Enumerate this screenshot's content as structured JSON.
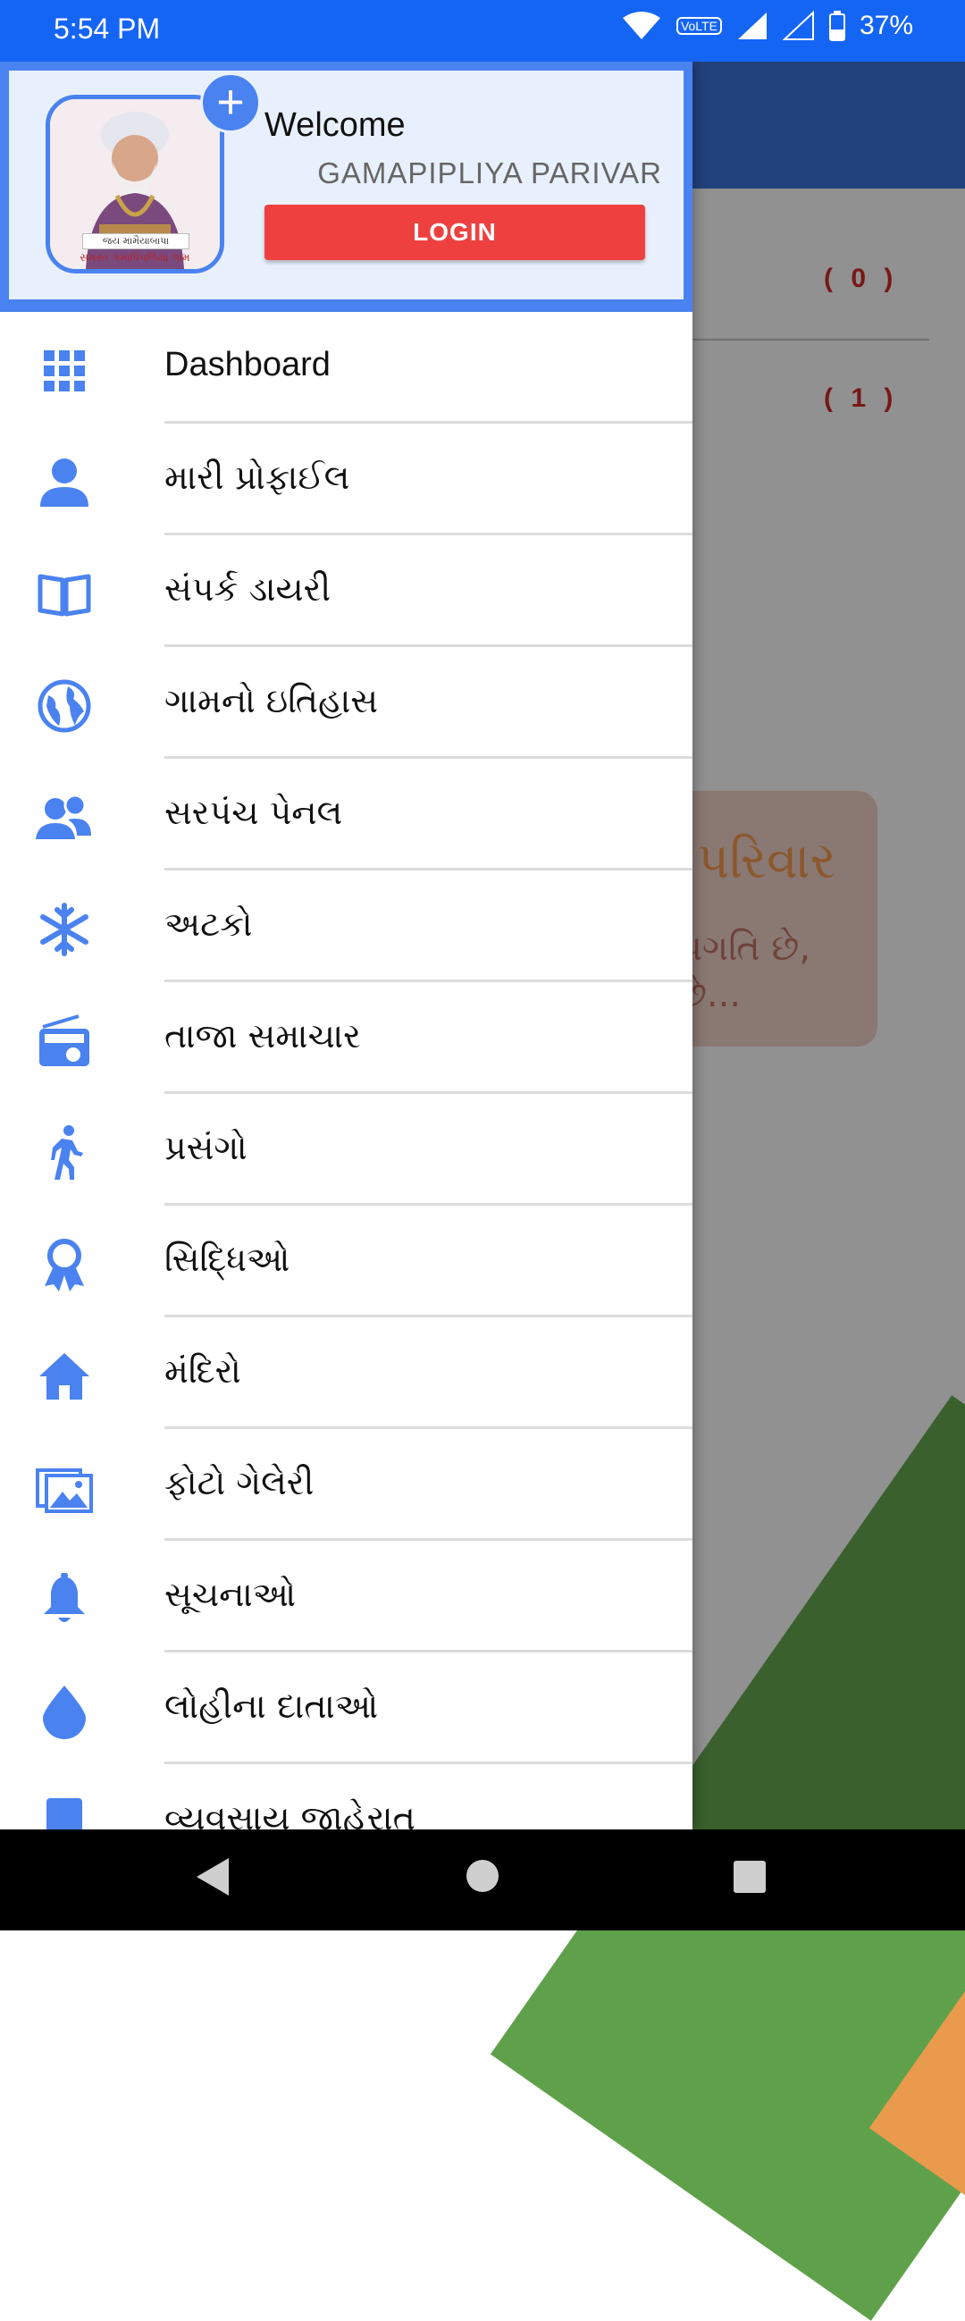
{
  "status_bar": {
    "time": "5:54 PM",
    "battery": "37%",
    "network_badge": "VoLTE"
  },
  "background": {
    "counts": [
      "( 0 )",
      "( 1 )"
    ],
    "card_title": "પરિવાર",
    "card_text_line1": "પ્રગતિ છે,",
    "card_text_line2": "છે..."
  },
  "drawer": {
    "welcome": "Welcome",
    "org_name": "GAMAPIPLIYA PARIVAR",
    "login_label": "LOGIN",
    "avatar_caption_top": "જય મામૈયાબાપા",
    "avatar_caption_bottom": "સમસ્ત ગમાપિપળિયા ગામ",
    "add_icon": "plus-icon",
    "items": [
      {
        "label": "Dashboard",
        "icon": "grid-icon"
      },
      {
        "label": "મારી પ્રોફાઈલ",
        "icon": "person-icon"
      },
      {
        "label": "સંપર્ક ડાયરી",
        "icon": "book-icon"
      },
      {
        "label": "ગામનો ઇતિહાસ",
        "icon": "globe-icon"
      },
      {
        "label": "સરપંચ પેનલ",
        "icon": "people-icon"
      },
      {
        "label": "અટકો",
        "icon": "snowflake-icon"
      },
      {
        "label": "તાજા સમાચાર",
        "icon": "radio-icon"
      },
      {
        "label": "પ્રસંગો",
        "icon": "walk-icon"
      },
      {
        "label": "સિદ્ધિઓ",
        "icon": "award-icon"
      },
      {
        "label": "મંદિરો",
        "icon": "home-icon"
      },
      {
        "label": "ફોટો ગેલેરી",
        "icon": "gallery-icon"
      },
      {
        "label": "સૂચનાઓ",
        "icon": "bell-icon"
      },
      {
        "label": "લોહીના દાતાઓ",
        "icon": "drop-icon"
      },
      {
        "label": "વ્યવસાય જાહેરાત",
        "icon": "business-icon"
      }
    ]
  },
  "colors": {
    "accent": "#4a82f0",
    "status_bar": "#1565f5",
    "login": "#ef4040",
    "count_text": "#c62828"
  }
}
